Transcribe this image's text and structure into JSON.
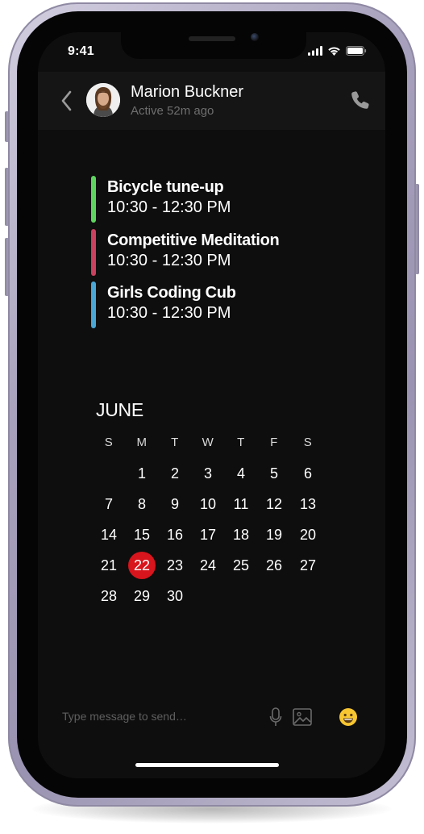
{
  "status_bar": {
    "time": "9:41",
    "icons": [
      "cellular-signal-icon",
      "wifi-icon",
      "battery-icon"
    ]
  },
  "header": {
    "contact_name": "Marion Buckner",
    "contact_status": "Active 52m ago",
    "icons": [
      "chevron-left-icon",
      "phone-icon"
    ]
  },
  "events": [
    {
      "title": "Bicycle tune-up",
      "time": "10:30 - 12:30 PM",
      "color": "#5fd35f"
    },
    {
      "title": "Competitive Meditation",
      "time": "10:30 - 12:30 PM",
      "color": "#c9415f"
    },
    {
      "title": "Girls Coding Cub",
      "time": "10:30 - 12:30 PM",
      "color": "#4aa6d4"
    }
  ],
  "calendar": {
    "month": "JUNE",
    "weekdays": [
      "S",
      "M",
      "T",
      "W",
      "T",
      "F",
      "S"
    ],
    "weeks": [
      [
        "",
        "1",
        "2",
        "3",
        "4",
        "5",
        "6"
      ],
      [
        "7",
        "8",
        "9",
        "10",
        "11",
        "12",
        "13"
      ],
      [
        "14",
        "15",
        "16",
        "17",
        "18",
        "19",
        "20"
      ],
      [
        "21",
        "22",
        "23",
        "24",
        "25",
        "26",
        "27"
      ],
      [
        "28",
        "29",
        "30",
        "",
        "",
        "",
        ""
      ]
    ],
    "selected_day": "22",
    "selected_color": "#d8141c"
  },
  "composer": {
    "placeholder": "Type message to send…",
    "icons": [
      "microphone-icon",
      "image-icon",
      "emoji-icon"
    ]
  },
  "colors": {
    "screen_background": "#0e0e0e",
    "header_background": "#151515",
    "frame": "#a8a1bd"
  }
}
